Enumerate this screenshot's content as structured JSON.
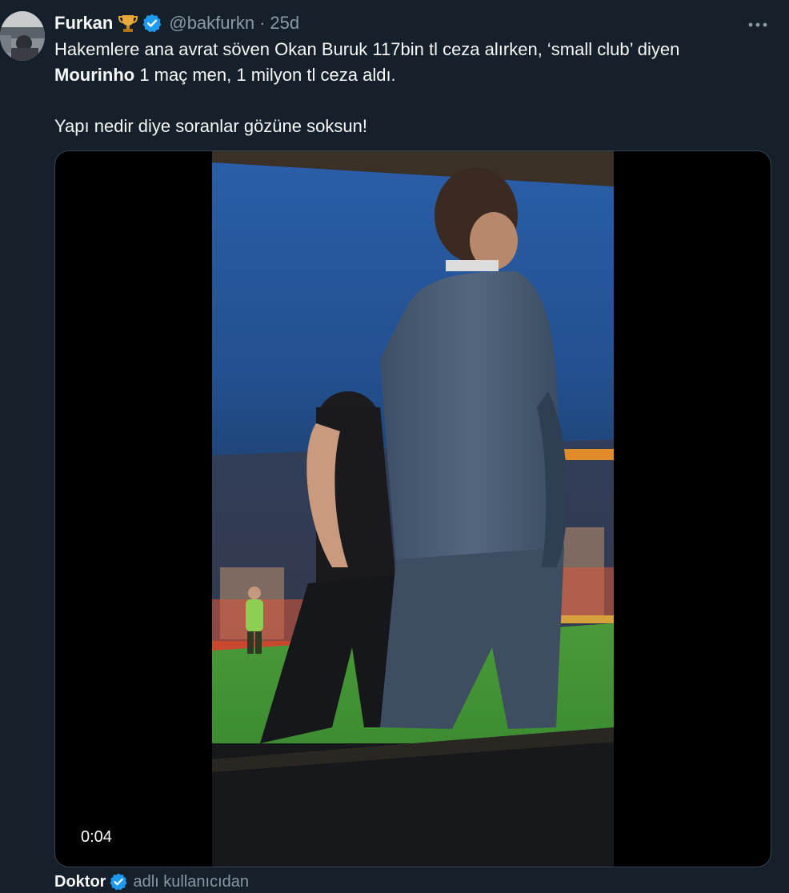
{
  "tweet": {
    "author": {
      "display_name": "Furkan",
      "handle": "@bakfurkn",
      "badge_icon": "trophy-icon",
      "verified_icon": "verified-icon",
      "verified_color": "#1d9bf0"
    },
    "separator": "·",
    "time": "25d",
    "text": {
      "line1": "Hakemlere ana avrat söven Okan Buruk 117bin tl ceza alırken, ‘small club’ diyen",
      "bold_name": "Mourinho",
      "line2_rest": " 1 maç men, 1 milyon tl ceza aldı.",
      "line3": "Yapı nedir diye soranlar gözüne soksun!"
    },
    "media": {
      "type": "video",
      "timestamp": "0:04"
    },
    "attribution": {
      "name": "Doktor",
      "suffix": "adlı kullanıcıdan"
    }
  },
  "colors": {
    "background": "#15202b",
    "text": "#f7f9f9",
    "secondary": "#8b98a5",
    "accent": "#1d9bf0"
  }
}
